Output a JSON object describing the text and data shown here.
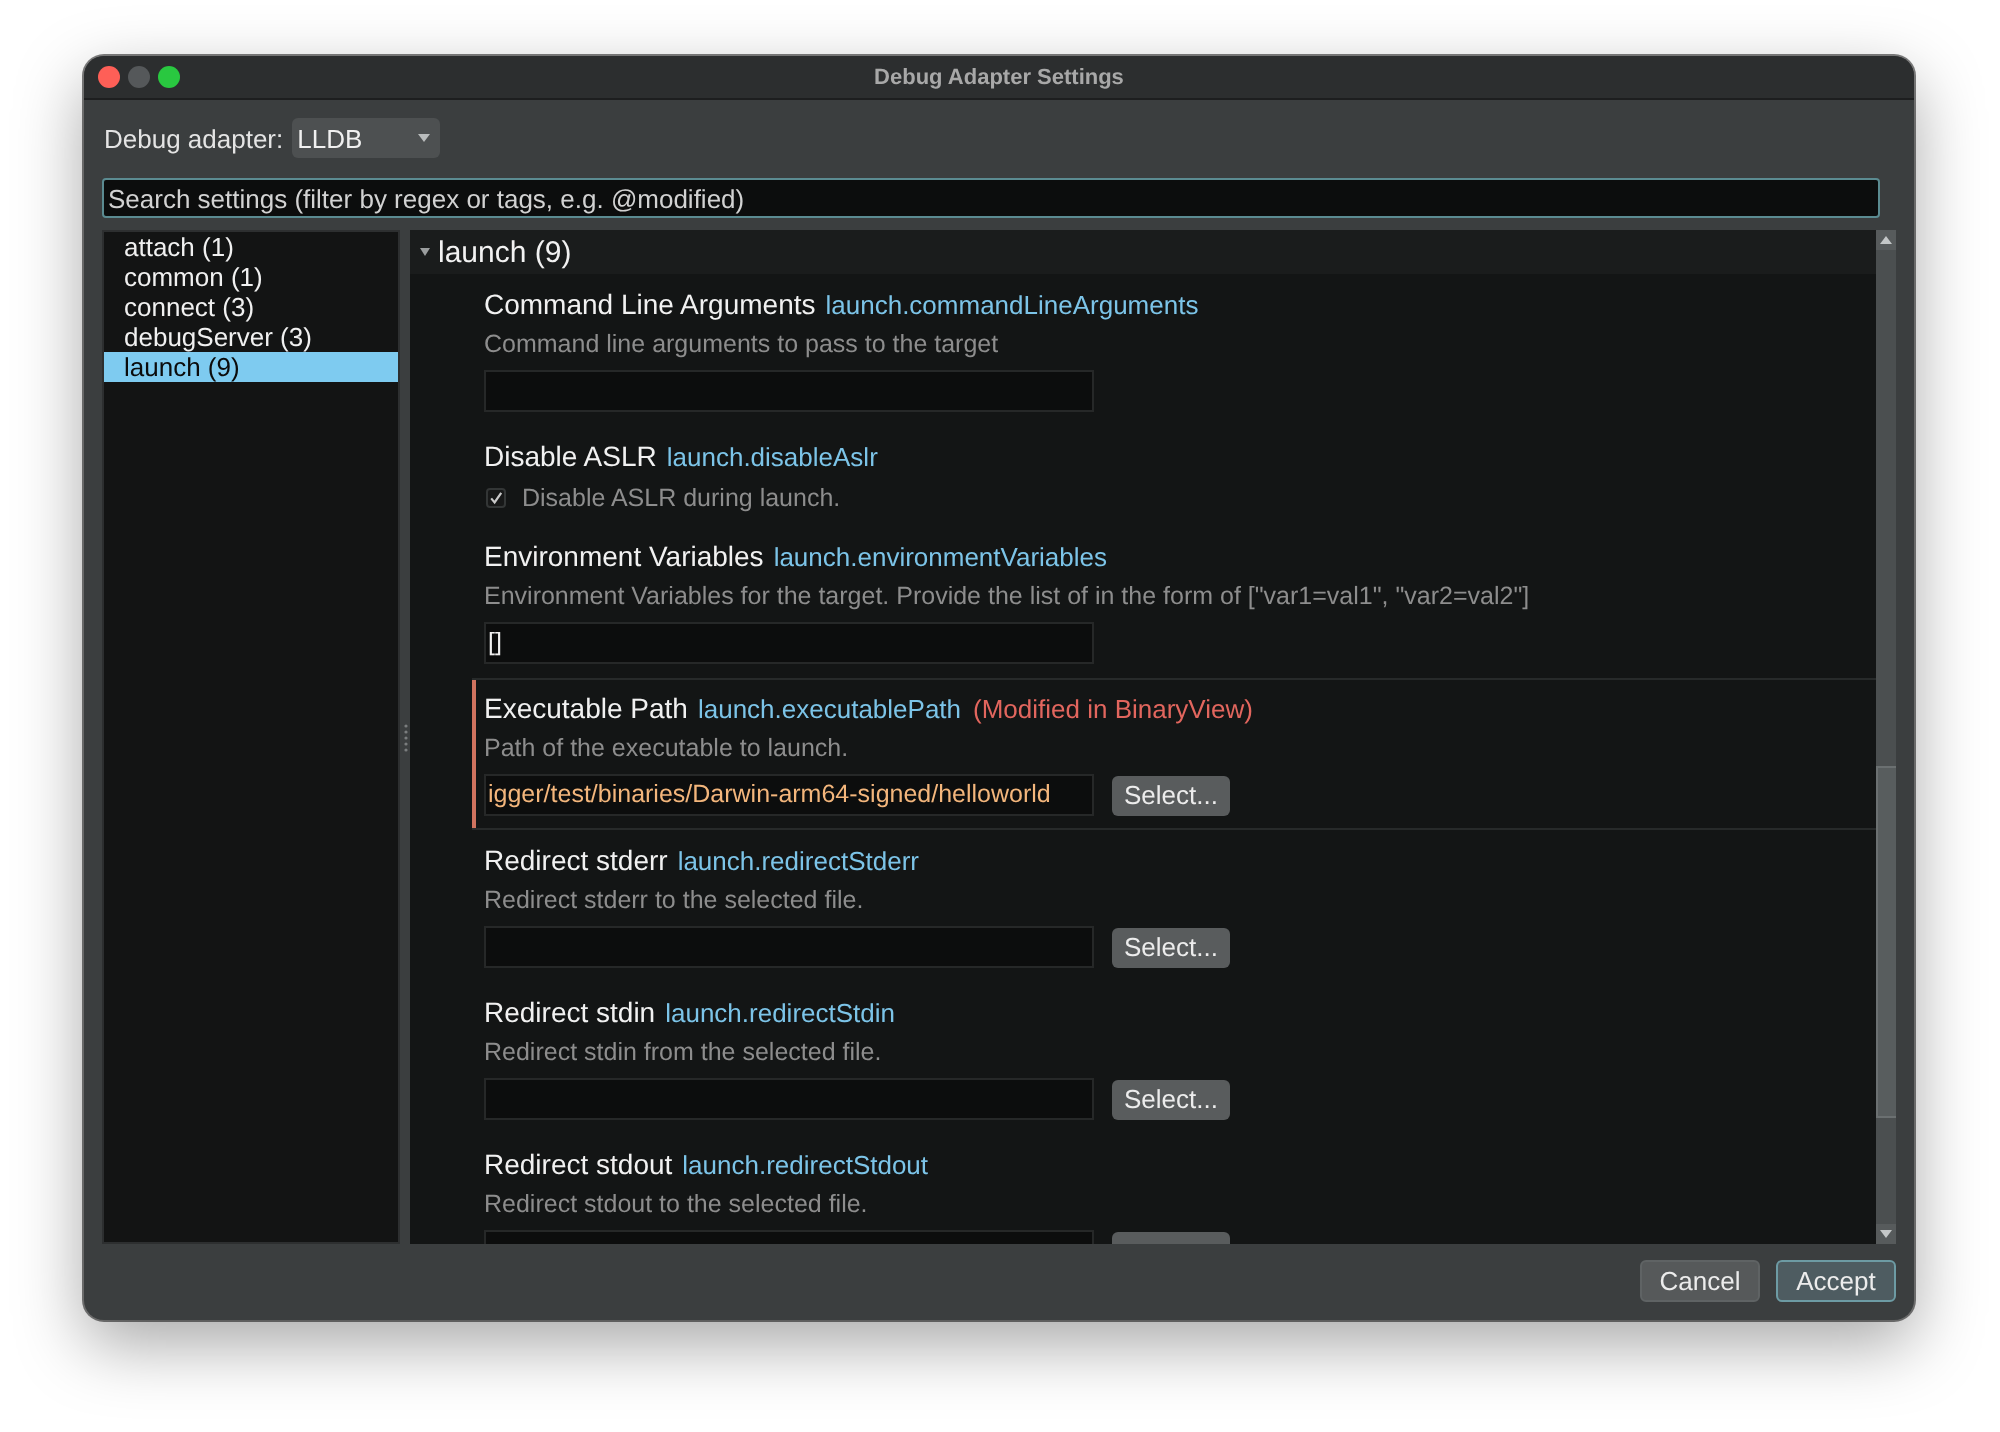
{
  "window": {
    "title": "Debug Adapter Settings",
    "controls": [
      {
        "kind": "close",
        "disabled": false
      },
      {
        "kind": "minimize",
        "disabled": true
      },
      {
        "kind": "zoom",
        "disabled": false
      }
    ]
  },
  "adapter": {
    "label": "Debug adapter:",
    "value": "LLDB"
  },
  "search": {
    "placeholder": "Search settings (filter by regex or tags, e.g. @modified)"
  },
  "sidebar": {
    "items": [
      {
        "label": "attach (1)",
        "selected": false
      },
      {
        "label": "common (1)",
        "selected": false
      },
      {
        "label": "connect (3)",
        "selected": false
      },
      {
        "label": "debugServer (3)",
        "selected": false
      },
      {
        "label": "launch (9)",
        "selected": true
      }
    ]
  },
  "group": {
    "title": "launch (9)",
    "expanded": true
  },
  "settings": [
    {
      "kind": "text",
      "title": "Command Line Arguments",
      "key": "launch.commandLineArguments",
      "description": "Command line arguments to pass to the target",
      "modified": false
    },
    {
      "kind": "checkbox",
      "title": "Disable ASLR",
      "key": "launch.disableAslr",
      "label": "Disable ASLR during launch.",
      "checked": true,
      "modified": false
    },
    {
      "kind": "text",
      "title": "Environment Variables",
      "key": "launch.environmentVariables",
      "description": "Environment Variables for the target. Provide the list of in the form of [\"var1=val1\", \"var2=val2\"]",
      "value": "[]",
      "modified": false
    },
    {
      "kind": "file",
      "title": "Executable Path",
      "key": "launch.executablePath",
      "note": "(Modified in BinaryView)",
      "description": "Path of the executable to launch.",
      "value": "igger/test/binaries/Darwin-arm64-signed/helloworld",
      "button": "Select...",
      "modified": true
    },
    {
      "kind": "file",
      "title": "Redirect stderr",
      "key": "launch.redirectStderr",
      "description": "Redirect stderr to the selected file.",
      "button": "Select...",
      "modified": false
    },
    {
      "kind": "file",
      "title": "Redirect stdin",
      "key": "launch.redirectStdin",
      "description": "Redirect stdin from the selected file.",
      "button": "Select...",
      "modified": false
    },
    {
      "kind": "file",
      "title": "Redirect stdout",
      "key": "launch.redirectStdout",
      "description": "Redirect stdout to the selected file.",
      "modified": false
    }
  ],
  "buttons": [
    {
      "kind": "cancel",
      "label": "Cancel"
    },
    {
      "kind": "accept",
      "label": "Accept"
    }
  ]
}
